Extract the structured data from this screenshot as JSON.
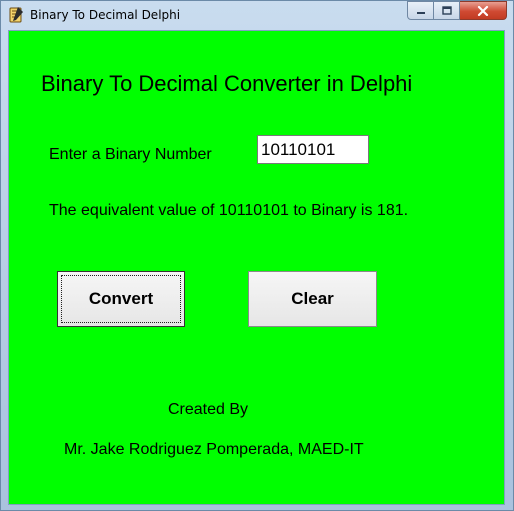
{
  "window": {
    "title": "Binary To Decimal Delphi",
    "controls": [
      "minimize",
      "maximize",
      "close"
    ]
  },
  "form": {
    "background_color": "#00ff00",
    "heading": "Binary To Decimal Converter in Delphi",
    "input_label": "Enter a Binary Number",
    "input_value": "10110101",
    "result_text": "The equivalent value of 10110101 to Binary is 181.",
    "convert_label": "Convert",
    "clear_label": "Clear",
    "created_by_label": "Created By",
    "author": "Mr. Jake Rodriguez Pomperada, MAED-IT"
  }
}
